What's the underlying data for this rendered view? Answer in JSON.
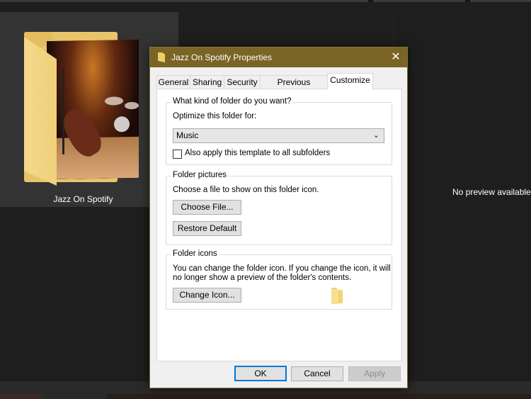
{
  "explorer": {
    "folder_name": "Jazz On Spotify",
    "preview_message": "No preview available."
  },
  "dialog": {
    "title": "Jazz On Spotify Properties",
    "close_glyph": "✕",
    "tabs": [
      {
        "label": "General"
      },
      {
        "label": "Sharing"
      },
      {
        "label": "Security"
      },
      {
        "label": "Previous Versions"
      },
      {
        "label": "Customize",
        "active": true
      }
    ],
    "folder_type": {
      "group_title": "What kind of folder do you want?",
      "optimize_label": "Optimize this folder for:",
      "selected": "Music",
      "subfolders_checkbox": "Also apply this template to all subfolders",
      "subfolders_checked": false
    },
    "folder_pictures": {
      "group_title": "Folder pictures",
      "description": "Choose a file to show on this folder icon.",
      "choose_button": "Choose File...",
      "restore_button": "Restore Default"
    },
    "folder_icons": {
      "group_title": "Folder icons",
      "description_line1": "You can change the folder icon. If you change the icon, it will",
      "description_line2": "no longer show a preview of the folder's contents.",
      "change_button": "Change Icon..."
    },
    "footer": {
      "ok": "OK",
      "cancel": "Cancel",
      "apply": "Apply"
    }
  },
  "colors": {
    "titlebar": "#7a6426",
    "folder_yellow": "#f0cd66",
    "focus_border": "#0078d7",
    "background": "#1e1e1e"
  }
}
